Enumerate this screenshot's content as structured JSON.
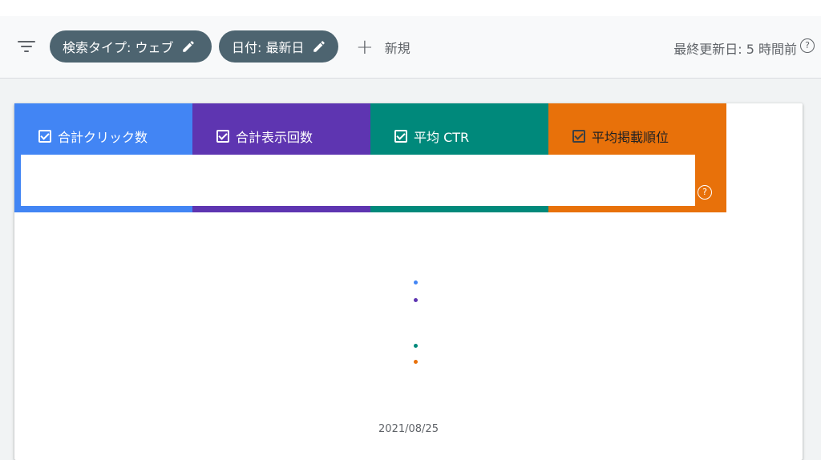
{
  "toolbar": {
    "filter_chips": [
      {
        "label": "検索タイプ: ウェブ"
      },
      {
        "label": "日付: 最新日"
      }
    ],
    "new_label": "新規",
    "last_updated": "最終更新日: 5 時間前",
    "help_icon": "?"
  },
  "metrics": [
    {
      "label": "合計クリック数",
      "color": "#4285f4",
      "checked": true
    },
    {
      "label": "合計表示回数",
      "color": "#5e35b1",
      "checked": true
    },
    {
      "label": "平均 CTR",
      "color": "#00897b",
      "checked": true
    },
    {
      "label": "平均掲載順位",
      "color": "#e8710a",
      "checked": true
    }
  ],
  "tile_help_icon": "?",
  "chart_data": {
    "type": "scatter",
    "x": [
      "2021/08/25"
    ],
    "series": [
      {
        "color": "#4285f4"
      },
      {
        "color": "#5e35b1"
      },
      {
        "color": "#00897b"
      },
      {
        "color": "#e8710a"
      }
    ],
    "xlabel": "",
    "ylabel": ""
  }
}
